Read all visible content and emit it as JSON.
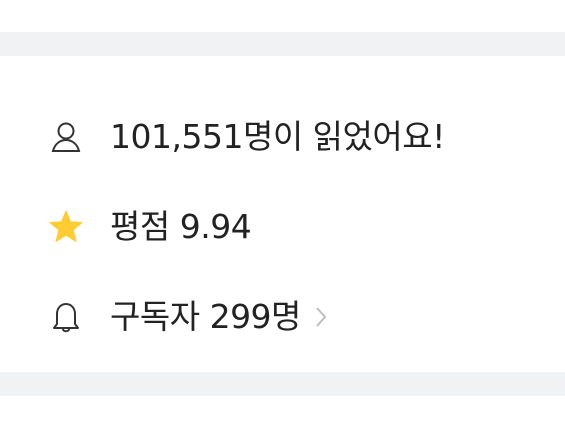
{
  "stats": {
    "readers_text": "101,551명이 읽었어요!",
    "rating_text": "평점 9.94",
    "subscribers_text": "구독자 299명"
  },
  "icons": {
    "readers": "user-icon",
    "rating": "star-icon",
    "subscribers": "bell-icon",
    "more": "chevron-right-icon"
  },
  "colors": {
    "band": "#f1f2f4",
    "text": "#222222",
    "star": "#ffcc33",
    "chevron": "#bdbdbd"
  }
}
